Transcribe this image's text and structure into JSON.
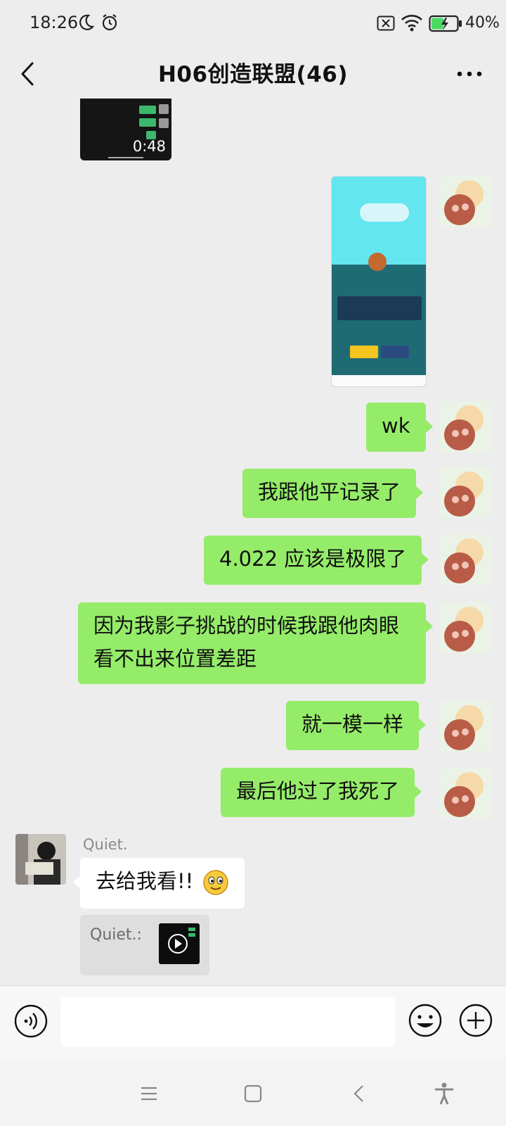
{
  "status_bar": {
    "time": "18:26",
    "battery": "40%"
  },
  "header": {
    "title": "H06创造联盟(46)"
  },
  "video": {
    "duration": "0:48"
  },
  "messages": {
    "m1": "wk",
    "m2": "我跟他平记录了",
    "m3": "4.022 应该是极限了",
    "m4": "因为我影子挑战的时候我跟他肉眼看不出来位置差距",
    "m5": "就一模一样",
    "m6": "最后他过了我死了",
    "other_name": "Quiet.",
    "other_text": "去给我看!!",
    "quote_label": "Quiet.:"
  },
  "input": {
    "value": ""
  },
  "colors": {
    "me_bubble": "#95ec69",
    "other_bubble": "#ffffff",
    "background": "#ededed"
  }
}
